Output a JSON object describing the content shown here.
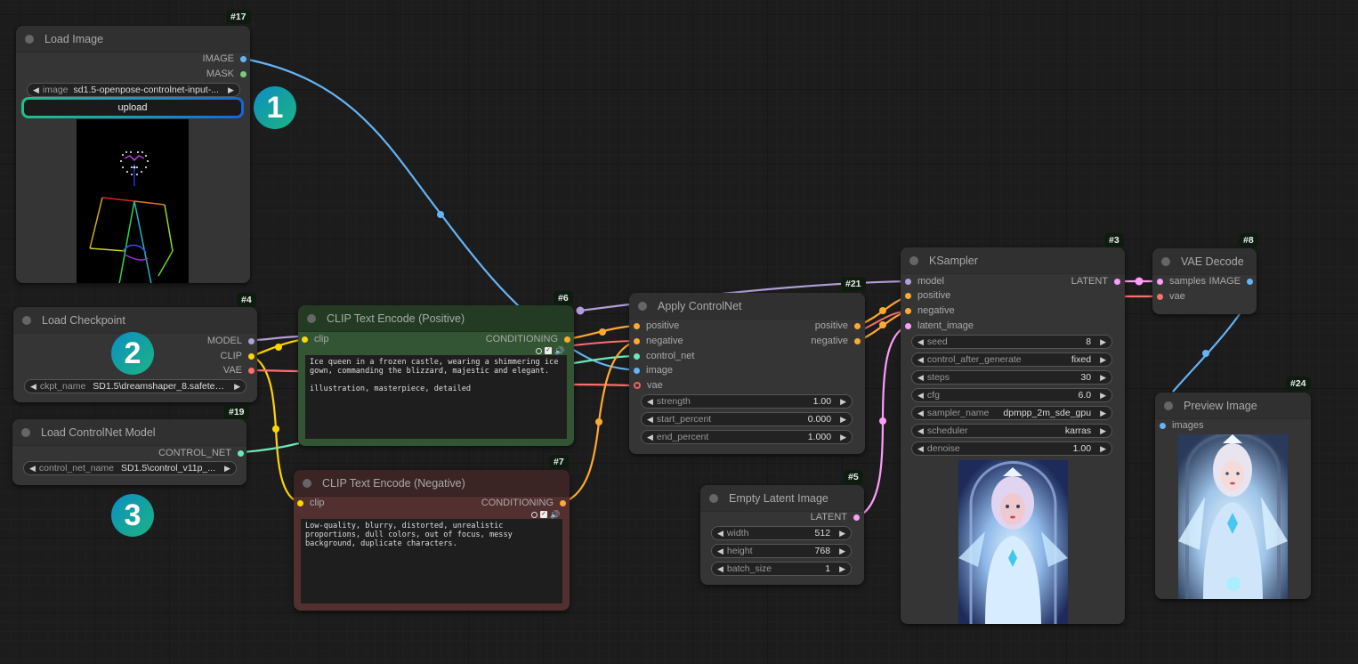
{
  "canvas": {
    "accent_colors": {
      "image": "#64b5f6",
      "mask": "#81c784",
      "model": "#b39ddb",
      "clip": "#ffd500",
      "vae": "#ff6e6e",
      "conditioning": "#ffa931",
      "control_net": "#6ee7b7",
      "latent": "#ff9cf9"
    }
  },
  "badges": [
    "1",
    "2",
    "3"
  ],
  "nodes": {
    "load_image": {
      "id": "#17",
      "title": "Load Image",
      "outputs": [
        "IMAGE",
        "MASK"
      ],
      "image_widget": {
        "label": "image",
        "value": "sd1.5-openpose-controlnet-input-..."
      },
      "upload_label": "upload",
      "preview_alt": "openpose skeleton preview"
    },
    "load_checkpoint": {
      "id": "#4",
      "title": "Load Checkpoint",
      "outputs": [
        "MODEL",
        "CLIP",
        "VAE"
      ],
      "ckpt_widget": {
        "label": "ckpt_name",
        "value": "SD1.5\\dreamshaper_8.safeten..."
      }
    },
    "load_controlnet": {
      "id": "#19",
      "title": "Load ControlNet Model",
      "outputs": [
        "CONTROL_NET"
      ],
      "cn_widget": {
        "label": "control_net_name",
        "value": "SD1.5\\control_v11p_..."
      }
    },
    "clip_positive": {
      "id": "#6",
      "title": "CLIP Text Encode (Positive)",
      "input": "clip",
      "output": "CONDITIONING",
      "text": "Ice queen in a frozen castle, wearing a shimmering ice gown, commanding the blizzard, majestic and elegant.\n\nillustration, masterpiece, detailed"
    },
    "clip_negative": {
      "id": "#7",
      "title": "CLIP Text Encode (Negative)",
      "input": "clip",
      "output": "CONDITIONING",
      "text": "Low-quality, blurry, distorted, unrealistic proportions, dull colors, out of focus, messy background, duplicate characters."
    },
    "apply_controlnet": {
      "id": "#21",
      "title": "Apply ControlNet",
      "inputs": [
        "positive",
        "negative",
        "control_net",
        "image",
        "vae"
      ],
      "outputs": [
        "positive",
        "negative"
      ],
      "widgets": [
        {
          "label": "strength",
          "value": "1.00"
        },
        {
          "label": "start_percent",
          "value": "0.000"
        },
        {
          "label": "end_percent",
          "value": "1.000"
        }
      ]
    },
    "ksampler": {
      "id": "#3",
      "title": "KSampler",
      "inputs": [
        "model",
        "positive",
        "negative",
        "latent_image"
      ],
      "output": "LATENT",
      "widgets": [
        {
          "label": "seed",
          "value": "8"
        },
        {
          "label": "control_after_generate",
          "value": "fixed"
        },
        {
          "label": "steps",
          "value": "30"
        },
        {
          "label": "cfg",
          "value": "6.0"
        },
        {
          "label": "sampler_name",
          "value": "dpmpp_2m_sde_gpu"
        },
        {
          "label": "scheduler",
          "value": "karras"
        },
        {
          "label": "denoise",
          "value": "1.00"
        }
      ]
    },
    "empty_latent": {
      "id": "#5",
      "title": "Empty Latent Image",
      "output": "LATENT",
      "widgets": [
        {
          "label": "width",
          "value": "512"
        },
        {
          "label": "height",
          "value": "768"
        },
        {
          "label": "batch_size",
          "value": "1"
        }
      ]
    },
    "vae_decode": {
      "id": "#8",
      "title": "VAE Decode",
      "inputs": [
        "samples",
        "vae"
      ],
      "output": "IMAGE"
    },
    "preview_image": {
      "id": "#24",
      "title": "Preview Image",
      "input": "images"
    }
  }
}
